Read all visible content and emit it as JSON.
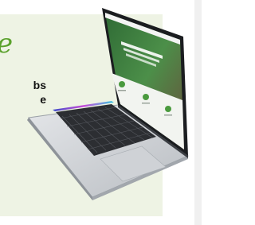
{
  "promo": {
    "script_mark": "e",
    "headline_line1": "bs",
    "headline_line2": "e",
    "accent_color": "#5aa12c",
    "panel_color": "#eef3e4"
  },
  "laptop": {
    "device": "laptop-mockup",
    "screen": {
      "hero_heading": "",
      "feature_icons": [
        "feature-icon-1",
        "feature-icon-2",
        "feature-icon-3"
      ],
      "accent_color": "#4a9a3e"
    }
  }
}
